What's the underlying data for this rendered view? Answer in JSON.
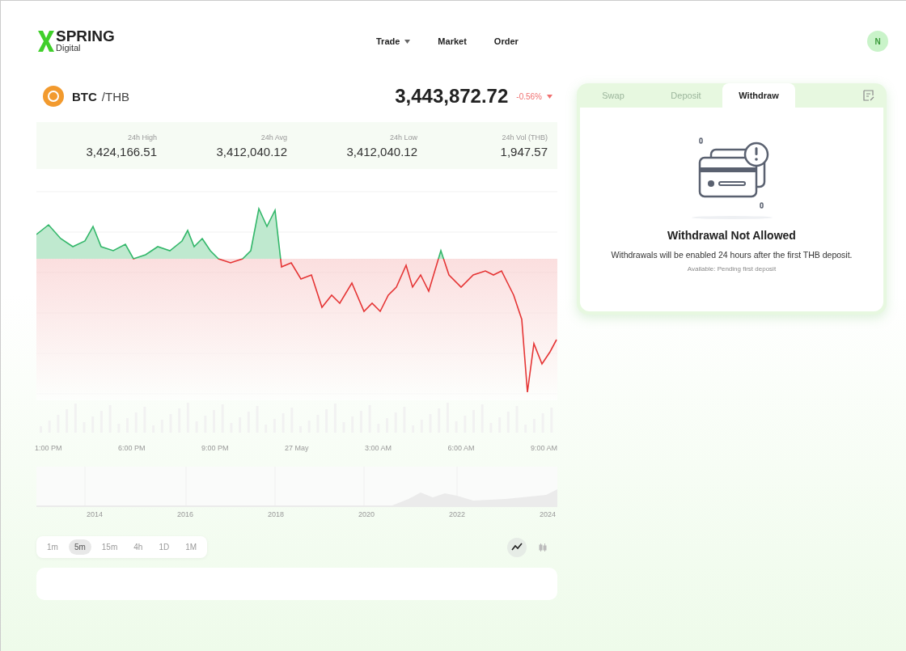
{
  "header": {
    "logo": {
      "name": "SPRING",
      "sub": "Digital"
    },
    "nav": [
      {
        "label": "Trade",
        "has_menu": true
      },
      {
        "label": "Market",
        "has_menu": false
      },
      {
        "label": "Order",
        "has_menu": false
      }
    ],
    "avatar": "N"
  },
  "pair": {
    "base": "BTC",
    "quote": "/THB",
    "price": "3,443,872.72",
    "change": "-0.56%",
    "negative": true
  },
  "stats": [
    {
      "label": "24h High",
      "value": "3,424,166.51"
    },
    {
      "label": "24h Avg",
      "value": "3,412,040.12"
    },
    {
      "label": "24h Low",
      "value": "3,412,040.12"
    },
    {
      "label": "24h Vol (THB)",
      "value": "1,947.57"
    }
  ],
  "chart": {
    "time_labels": [
      "1:00 PM",
      "6:00 PM",
      "9:00 PM",
      "27 May",
      "3:00 AM",
      "6:00 AM",
      "9:00 AM"
    ],
    "year_labels": [
      "2014",
      "2016",
      "2018",
      "2020",
      "2022",
      "2024"
    ]
  },
  "timeframes": [
    {
      "label": "1m",
      "selected": false
    },
    {
      "label": "5m",
      "selected": true
    },
    {
      "label": "15m",
      "selected": false
    },
    {
      "label": "4h",
      "selected": false
    },
    {
      "label": "1D",
      "selected": false
    },
    {
      "label": "1M",
      "selected": false
    }
  ],
  "chart_types": [
    {
      "kind": "line",
      "selected": true
    },
    {
      "kind": "candles",
      "selected": false
    }
  ],
  "panel": {
    "tabs": [
      {
        "label": "Swap",
        "selected": false
      },
      {
        "label": "Deposit",
        "selected": false
      },
      {
        "label": "Withdraw",
        "selected": true
      }
    ],
    "title": "Withdrawal Not Allowed",
    "message": "Withdrawals will be enabled 24 hours after the first THB deposit.",
    "note": "Available: Pending first deposit"
  }
}
